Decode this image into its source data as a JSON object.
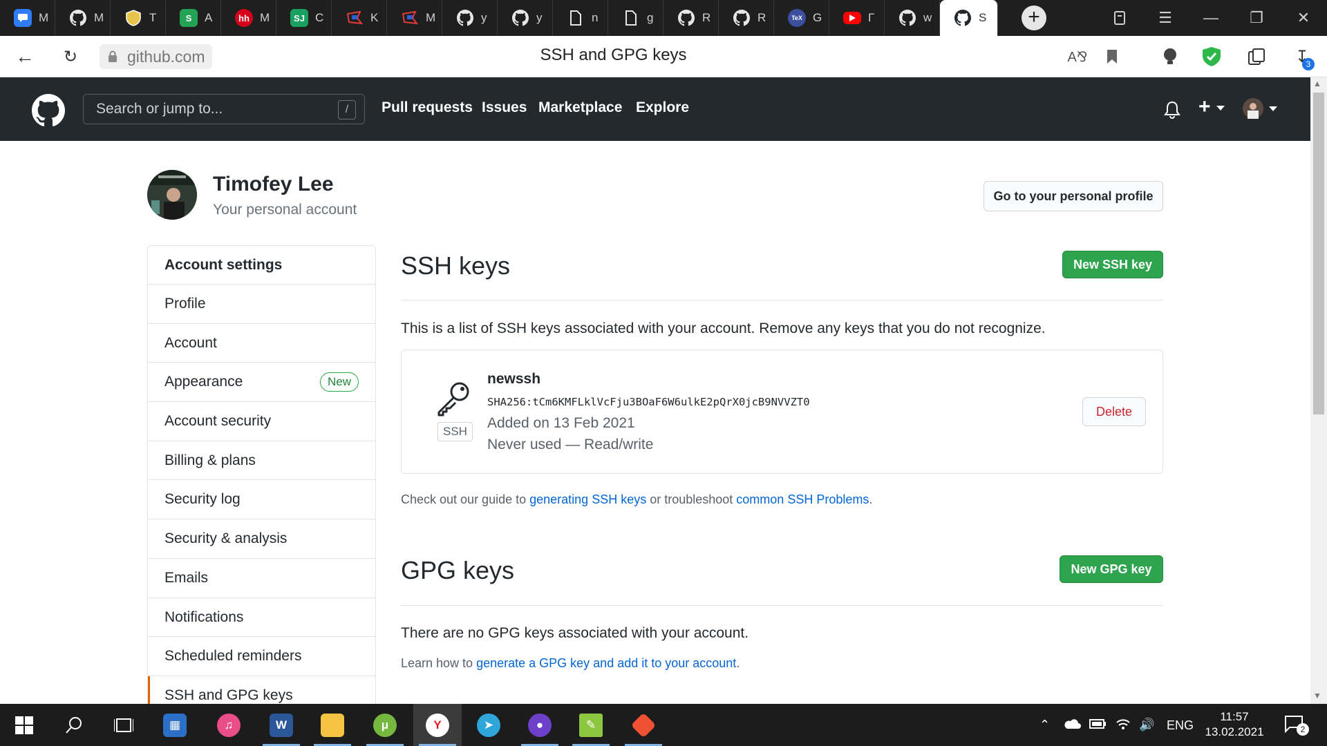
{
  "browser": {
    "tabs": [
      {
        "label": "M",
        "icon": "messenger-icon",
        "color": "#2e7cf6"
      },
      {
        "label": "M",
        "icon": "github-icon",
        "color": "#1f1f1f"
      },
      {
        "label": "T",
        "icon": "shield-crest-icon",
        "color": "#1f1f1f"
      },
      {
        "label": "A",
        "icon": "s-logo-icon",
        "color": "#23a455"
      },
      {
        "label": "M",
        "icon": "hh-icon",
        "color": "#d6001c"
      },
      {
        "label": "C",
        "icon": "sj-icon",
        "color": "#1aa162"
      },
      {
        "label": "K",
        "icon": "flag-icon",
        "color": "#1f1f1f"
      },
      {
        "label": "M",
        "icon": "flag-icon",
        "color": "#1f1f1f"
      },
      {
        "label": "y",
        "icon": "github-icon",
        "color": "#1f1f1f"
      },
      {
        "label": "y",
        "icon": "github-icon",
        "color": "#1f1f1f"
      },
      {
        "label": "n",
        "icon": "document-icon",
        "color": "#1f1f1f"
      },
      {
        "label": "g",
        "icon": "document-icon",
        "color": "#1f1f1f"
      },
      {
        "label": "R",
        "icon": "github-icon",
        "color": "#1f1f1f"
      },
      {
        "label": "R",
        "icon": "github-icon",
        "color": "#1f1f1f"
      },
      {
        "label": "G",
        "icon": "tex-icon",
        "color": "#3c4f9e"
      },
      {
        "label": "Г",
        "icon": "youtube-icon",
        "color": "#ff0000"
      },
      {
        "label": "w",
        "icon": "github-icon",
        "color": "#1f1f1f"
      },
      {
        "label": "S",
        "icon": "github-icon",
        "color": "#ffffff",
        "active": true
      }
    ],
    "new_tab": "+",
    "url": "github.com",
    "page_title": "SSH and GPG keys",
    "downloads_count": "3"
  },
  "header": {
    "search_placeholder": "Search or jump to...",
    "search_shortcut": "/",
    "nav": [
      "Pull requests",
      "Issues",
      "Marketplace",
      "Explore"
    ],
    "plus": "+"
  },
  "profile": {
    "name": "Timofey Lee",
    "subtitle": "Your personal account",
    "profile_button": "Go to your personal profile"
  },
  "sidebar": {
    "heading": "Account settings",
    "items": [
      {
        "label": "Profile"
      },
      {
        "label": "Account"
      },
      {
        "label": "Appearance",
        "badge": "New"
      },
      {
        "label": "Account security"
      },
      {
        "label": "Billing & plans"
      },
      {
        "label": "Security log"
      },
      {
        "label": "Security & analysis"
      },
      {
        "label": "Emails"
      },
      {
        "label": "Notifications"
      },
      {
        "label": "Scheduled reminders"
      },
      {
        "label": "SSH and GPG keys",
        "selected": true
      }
    ]
  },
  "ssh": {
    "title": "SSH keys",
    "new_button": "New SSH key",
    "description": "This is a list of SSH keys associated with your account. Remove any keys that you do not recognize.",
    "key": {
      "type": "SSH",
      "name": "newssh",
      "fingerprint": "SHA256:tCm6KMFLklVcFju3BOaF6W6ulkE2pQrX0jcB9NVVZT0",
      "added": "Added on 13 Feb 2021",
      "usage": "Never used — Read/write",
      "delete_label": "Delete"
    },
    "guide": {
      "prefix": "Check out our guide to ",
      "link1": "generating SSH keys",
      "middle": " or troubleshoot ",
      "link2": "common SSH Problems",
      "suffix": "."
    }
  },
  "gpg": {
    "title": "GPG keys",
    "new_button": "New GPG key",
    "empty": "There are no GPG keys associated with your account.",
    "learn_prefix": "Learn how to ",
    "learn_link": "generate a GPG key and add it to your account",
    "learn_suffix": "."
  },
  "taskbar": {
    "apps": [
      "windows-start-icon",
      "search-icon",
      "task-view-icon",
      "store-icon",
      "itunes-icon",
      "word-icon",
      "file-explorer-icon",
      "utorrent-icon",
      "yandex-browser-icon",
      "telegram-icon",
      "github-desktop-icon",
      "notepad-plus-icon",
      "git-icon"
    ],
    "language": "ENG",
    "time": "11:57",
    "date": "13.02.2021",
    "notifications": "2"
  },
  "colors": {
    "github_header": "#24292e",
    "primary_green": "#2ea44f",
    "link_blue": "#0366d6",
    "danger_red": "#cb2431",
    "selected_accent": "#e36209"
  }
}
